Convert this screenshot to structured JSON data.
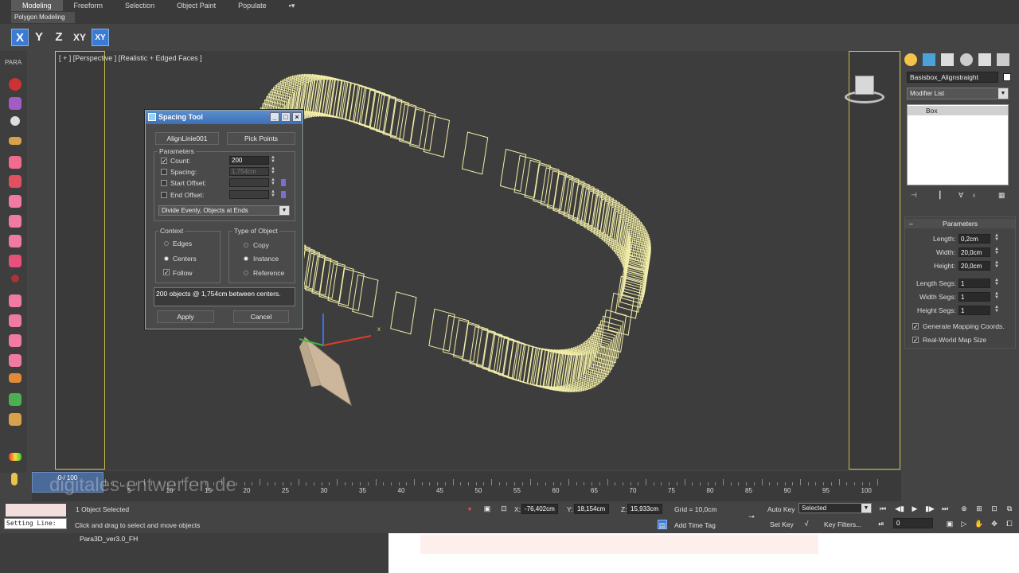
{
  "ribbon": {
    "tabs": [
      "Modeling",
      "Freeform",
      "Selection",
      "Object Paint",
      "Populate"
    ],
    "active_tab": "Modeling",
    "subpanel": "Polygon Modeling"
  },
  "axis_buttons": [
    "X",
    "Y",
    "Z",
    "XY",
    "XY"
  ],
  "left_toolbar": {
    "title": "PARA"
  },
  "viewport": {
    "label": "[ + ] [Perspective ] [Realistic + Edged Faces ]",
    "gizmo_x_label": "x"
  },
  "dialog": {
    "title": "Spacing Tool",
    "path_button": "AlignLinie001",
    "pick_points_button": "Pick Points",
    "parameters_title": "Parameters",
    "count_label": "Count:",
    "count_value": "200",
    "count_checked": true,
    "spacing_label": "Spacing:",
    "spacing_value": "1,754cm",
    "start_offset_label": "Start Offset:",
    "end_offset_label": "End Offset:",
    "distribution": "Divide Evenly, Objects at Ends",
    "context_title": "Context",
    "context_edges": "Edges",
    "context_centers": "Centers",
    "context_follow": "Follow",
    "type_title": "Type of Object",
    "type_copy": "Copy",
    "type_instance": "Instance",
    "type_reference": "Reference",
    "status": "200 objects @ 1,754cm  between centers.",
    "apply": "Apply",
    "cancel": "Cancel"
  },
  "command_panel": {
    "object_name": "Basisbox_Alignstraight",
    "modifier_list": "Modifier List",
    "stack_item": "Box",
    "rollout_title": "Parameters",
    "length_label": "Length:",
    "length_value": "0,2cm",
    "width_label": "Width:",
    "width_value": "20,0cm",
    "height_label": "Height:",
    "height_value": "20,0cm",
    "length_segs_label": "Length Segs:",
    "length_segs_value": "1",
    "width_segs_label": "Width Segs:",
    "width_segs_value": "1",
    "height_segs_label": "Height Segs:",
    "height_segs_value": "1",
    "gen_mapping": "Generate Mapping Coords.",
    "real_world": "Real-World Map Size"
  },
  "timeline": {
    "slider_label": "0 / 100",
    "ticks": [
      "5",
      "10",
      "15",
      "20",
      "25",
      "30",
      "35",
      "40",
      "45",
      "50",
      "55",
      "60",
      "65",
      "70",
      "75",
      "80",
      "85",
      "90",
      "95",
      "100"
    ],
    "watermark": "digitales-entwerfen.de"
  },
  "status": {
    "selection": "1 Object Selected",
    "prompt": "Click and drag to select and move objects",
    "listener": "Setting Line:",
    "x_label": "X:",
    "x_value": "-76,402cm",
    "y_label": "Y:",
    "y_value": "18,154cm",
    "z_label": "Z:",
    "z_value": "15,933cm",
    "grid": "Grid = 10,0cm",
    "add_time_tag": "Add Time Tag",
    "auto_key": "Auto Key",
    "set_key": "Set Key",
    "selected": "Selected",
    "key_filters": "Key Filters...",
    "frame": "0"
  },
  "taskbar": {
    "label": "Para3D_ver3.0_FH"
  }
}
